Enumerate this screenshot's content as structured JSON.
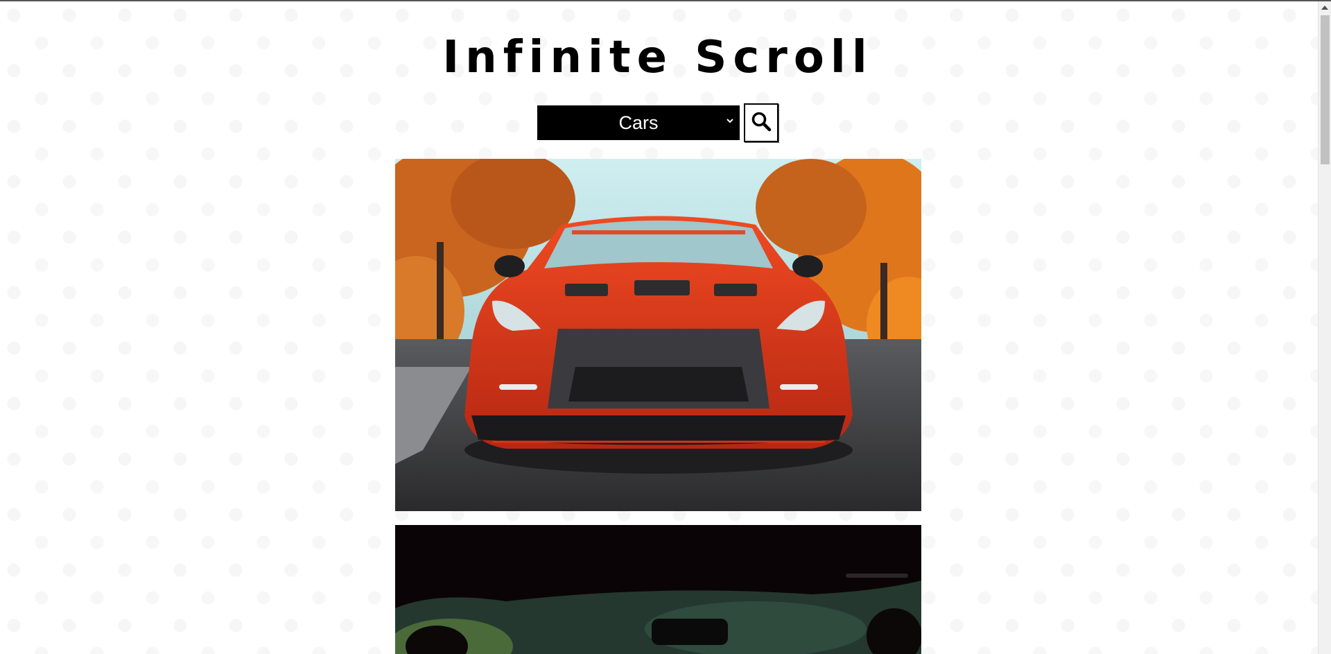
{
  "header": {
    "title": "Infinite Scroll"
  },
  "search": {
    "selected_category": "Cars",
    "chevron_icon": "chevron-down-icon",
    "button_icon": "search-icon"
  },
  "feed": {
    "images": [
      {
        "subject": "red sports car front view",
        "colors": {
          "sky": "#b9dfe4",
          "foliage": "#d86a1c",
          "body": "#e0371a",
          "road": "#3a3a3c"
        }
      },
      {
        "subject": "car interior windshield view",
        "colors": {
          "interior": "#0b0406",
          "glass": "#2e4a3f"
        }
      }
    ]
  },
  "scrollbar": {
    "up_icon": "arrow-up-icon"
  }
}
